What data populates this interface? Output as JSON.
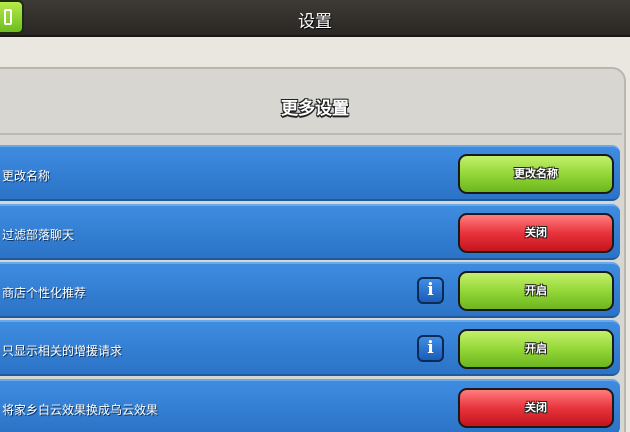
{
  "header": {
    "title": "设置"
  },
  "panel": {
    "title": "更多设置"
  },
  "colors": {
    "on": "#94d738",
    "off": "#e8343c",
    "row": "#3e8ce0"
  },
  "rows": [
    {
      "label": "更改名称",
      "button": "更改名称",
      "state": "green",
      "info": false
    },
    {
      "label": "过滤部落聊天",
      "button": "关闭",
      "state": "red",
      "info": false
    },
    {
      "label": "商店个性化推荐",
      "button": "开启",
      "state": "green",
      "info": true
    },
    {
      "label": "只显示相关的增援请求",
      "button": "开启",
      "state": "green",
      "info": true
    },
    {
      "label": "将家乡白云效果换成乌云效果",
      "button": "关闭",
      "state": "red",
      "info": false
    }
  ],
  "icons": {
    "info": "i",
    "back": "back-icon"
  }
}
